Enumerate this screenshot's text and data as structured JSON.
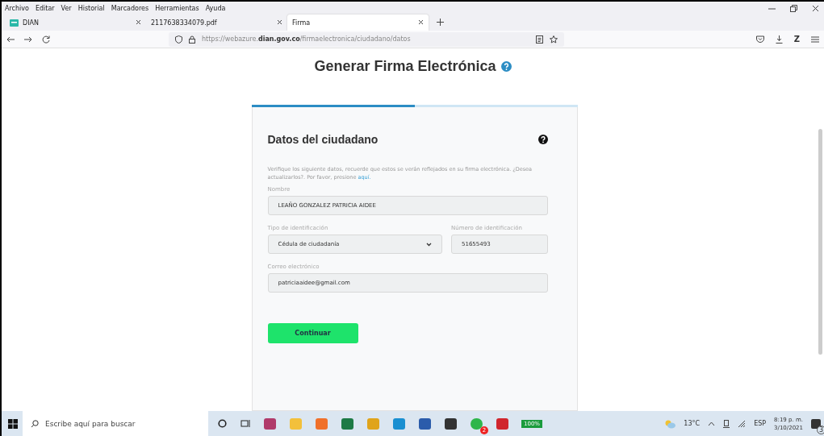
{
  "menu": [
    "Archivo",
    "Editar",
    "Ver",
    "Historial",
    "Marcadores",
    "Herramientas",
    "Ayuda"
  ],
  "tabs": [
    {
      "label": "DIAN",
      "selected": false
    },
    {
      "label": "2117638334079.pdf",
      "selected": false
    },
    {
      "label": "Firma",
      "selected": true
    }
  ],
  "extension_label": "Z",
  "address": {
    "prefix": "https://webazure.",
    "domain": "dian.gov.co",
    "path": "/firmaelectronica/ciudadano/datos"
  },
  "page": {
    "title": "Generar Firma Electrónica",
    "progress": {
      "level": 0.5
    },
    "card": {
      "title": "Datos del ciudadano",
      "intro": "Verifique los siguiente datos, recuerde que estos se verán reflejados en su firma electrónica. ¿Desea actualizarlos?. Por favor, presione ",
      "link": "aquí.",
      "name": {
        "label": "Nombre",
        "value": "LEAÑO GONZALEZ PATRICIA AIDEE"
      },
      "id_type": {
        "label": "Tipo de identificación",
        "value": "Cédula de ciudadanía"
      },
      "id_number": {
        "label": "Número de identificación",
        "value": "51655493"
      },
      "email": {
        "label": "Correo electrónico",
        "value": "patriciaaidee@gmail.com"
      },
      "button": "Continuar"
    }
  },
  "taskbar": {
    "search_placeholder": "Escribe aquí para buscar",
    "chat_badge": "2",
    "battery": "100%",
    "temperature": "13°C",
    "language": "ESP",
    "time": "8:19 p. m.",
    "date": "3/10/2021",
    "notifications": "3"
  }
}
